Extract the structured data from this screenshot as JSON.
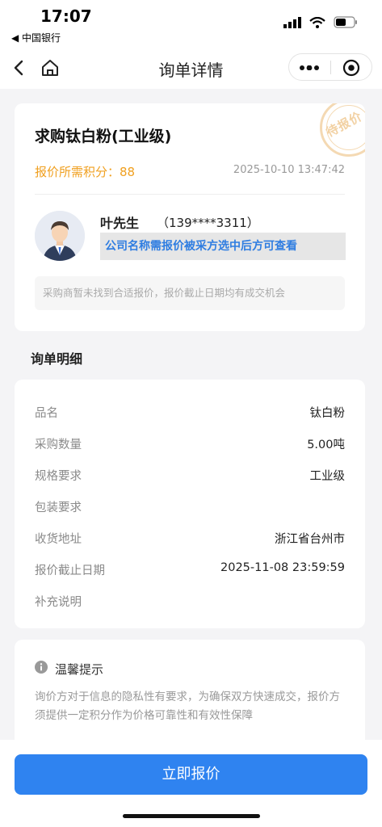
{
  "status_bar": {
    "time": "17:07",
    "back_app": "◀ 中国银行"
  },
  "nav": {
    "title": "询单详情"
  },
  "inquiry": {
    "title": "求购钛白粉(工业级)",
    "points_label": "报价所需积分：88",
    "date": "2025-10-10 13:47:42",
    "stamp": "待报价",
    "buyer_name": "叶先生",
    "buyer_phone": "（139****3311）",
    "notice": "公司名称需报价被采方选中后方可查看",
    "hint": "采购商暂未找到合适报价，报价截止日期均有成交机会"
  },
  "details": {
    "section_title": "询单明细",
    "rows": [
      {
        "label": "品名",
        "value": "钛白粉"
      },
      {
        "label": "采购数量",
        "value": "5.00吨"
      },
      {
        "label": "规格要求",
        "value": "工业级"
      },
      {
        "label": "包装要求",
        "value": ""
      },
      {
        "label": "收货地址",
        "value": "浙江省台州市"
      },
      {
        "label": "报价截止日期",
        "value": "2025-11-08 23:59:59"
      },
      {
        "label": "补充说明",
        "value": ""
      }
    ]
  },
  "tips": {
    "title": "温馨提示",
    "text": "询价方对于信息的隐私性有要求，为确保双方快速成交，报价方须提供一定积分作为价格可靠性和有效性保障"
  },
  "footer": {
    "button_label": "立即报价"
  },
  "colors": {
    "accent": "#2f83f0",
    "points": "#f0a020",
    "notice_text": "#2f7de1"
  }
}
